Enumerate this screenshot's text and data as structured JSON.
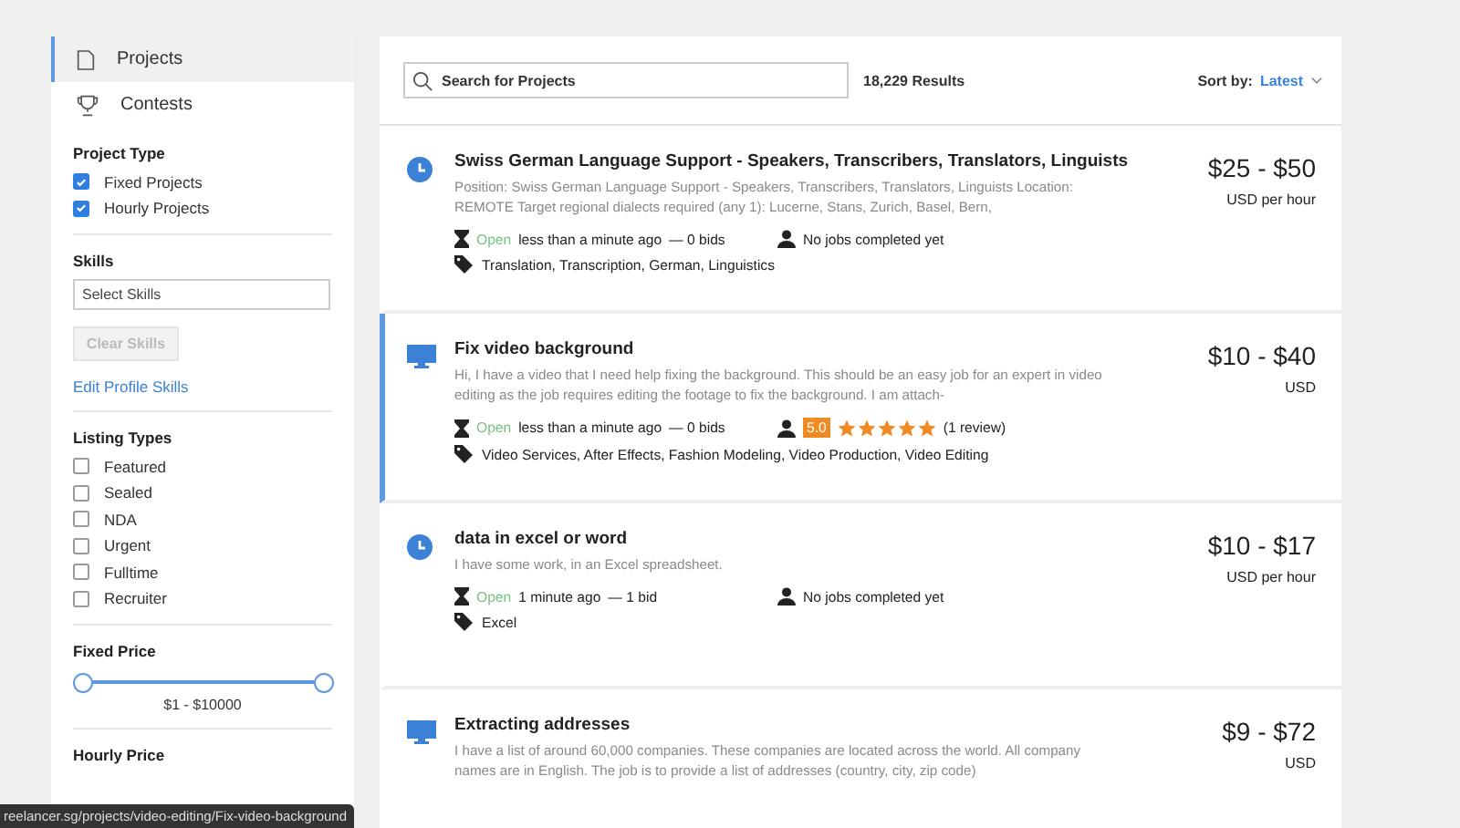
{
  "sidebar": {
    "nav": [
      {
        "label": "Projects",
        "kind": "document",
        "selected": true
      },
      {
        "label": "Contests",
        "kind": "trophy",
        "selected": false
      }
    ],
    "project_type": {
      "title": "Project Type",
      "options": [
        {
          "label": "Fixed Projects",
          "checked": true
        },
        {
          "label": "Hourly Projects",
          "checked": true
        }
      ]
    },
    "skills": {
      "title": "Skills",
      "placeholder": "Select Skills",
      "clear_button": {
        "label": "Clear Skills",
        "disabled": true
      },
      "link": "Edit Profile Skills"
    },
    "listing_types": {
      "title": "Listing Types",
      "options": [
        {
          "label": "Featured",
          "checked": false
        },
        {
          "label": "Sealed",
          "checked": false
        },
        {
          "label": "NDA",
          "checked": false
        },
        {
          "label": "Urgent",
          "checked": false
        },
        {
          "label": "Fulltime",
          "checked": false
        },
        {
          "label": "Recruiter",
          "checked": false
        }
      ]
    },
    "fixed_price": {
      "title": "Fixed Price",
      "thumbs": [
        {
          "level": 0
        },
        {
          "level": 1
        }
      ],
      "range": "$1 - $10000"
    },
    "hourly_price": {
      "title": "Hourly Price"
    }
  },
  "toolbar": {
    "search": {
      "placeholder": "Search for Projects"
    },
    "results": "18,229 Results",
    "sort_label": "Sort by:",
    "sort_value": "Latest"
  },
  "projects": [
    {
      "kind": "hourly",
      "selected": false,
      "title": "Swiss German Language Support - Speakers, Transcribers, Translators, Linguists",
      "description": "Position: Swiss German Language Support - Speakers, Transcribers, Translators, Linguists Location: REMOTE Target regional dialects required (any 1): Lucerne, Stans, Zurich, Basel, Bern,",
      "status": "Open",
      "time": "less than a minute ago",
      "bids": "— 0 bids",
      "employer": {
        "kind": "new",
        "text": "No jobs completed yet"
      },
      "tags": "Translation, Transcription, German, Linguistics",
      "price": "$25 - $50",
      "unit": "USD per hour"
    },
    {
      "kind": "fixed",
      "selected": true,
      "title": "Fix video background",
      "description": "Hi, I have a video that I need help fixing the background. This should be an easy job for an expert in video editing as the job requires editing the footage to fix the background. I am attach-",
      "status": "Open",
      "time": "less than a minute ago",
      "bids": "— 0 bids",
      "employer": {
        "kind": "rated",
        "rating": "5.0",
        "stars": 5,
        "reviews": "(1 review)"
      },
      "tags": "Video Services, After Effects, Fashion Modeling, Video Production, Video Editing",
      "price": "$10 - $40",
      "unit": "USD"
    },
    {
      "kind": "hourly",
      "selected": false,
      "title": "data in excel or word",
      "description": "I have some work, in an Excel spreadsheet.",
      "status": "Open",
      "time": "1 minute ago",
      "bids": "— 1 bid",
      "employer": {
        "kind": "new",
        "text": "No jobs completed yet"
      },
      "tags": "Excel",
      "price": "$10 - $17",
      "unit": "USD per hour"
    },
    {
      "kind": "fixed",
      "selected": false,
      "title": "Extracting addresses",
      "description": "I have a list of around 60,000 companies. These companies are located across the world. All company names are in English. The job is to provide a list of addresses (country, city, zip code)",
      "price": "$9 - $72",
      "unit": "USD"
    }
  ],
  "status_bar": {
    "url": "reelancer.sg/projects/video-editing/Fix-video-background"
  }
}
